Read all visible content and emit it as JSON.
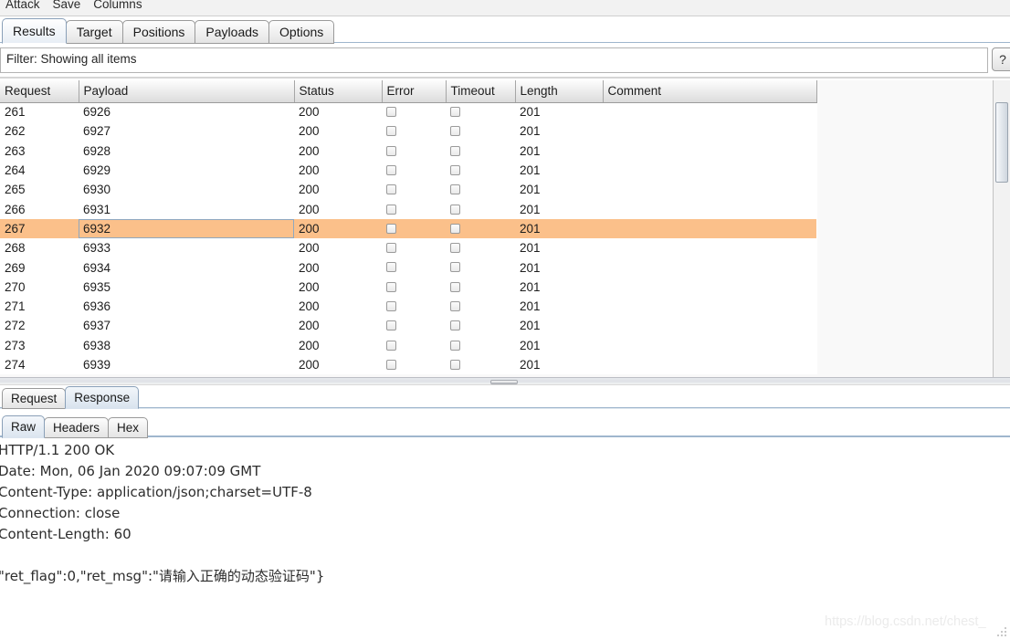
{
  "menubar": {
    "items": [
      {
        "label": "Attack"
      },
      {
        "label": "Save"
      },
      {
        "label": "Columns"
      }
    ]
  },
  "tabs": [
    {
      "label": "Results",
      "active": true
    },
    {
      "label": "Target",
      "active": false
    },
    {
      "label": "Positions",
      "active": false
    },
    {
      "label": "Payloads",
      "active": false
    },
    {
      "label": "Options",
      "active": false
    }
  ],
  "filter": {
    "text": "Filter: Showing all items",
    "help_label": "?"
  },
  "table": {
    "columns": [
      {
        "label": "Request"
      },
      {
        "label": "Payload"
      },
      {
        "label": "Status"
      },
      {
        "label": "Error"
      },
      {
        "label": "Timeout"
      },
      {
        "label": "Length"
      },
      {
        "label": "Comment"
      }
    ],
    "rows": [
      {
        "request": "261",
        "payload": "6926",
        "status": "200",
        "error": false,
        "timeout": false,
        "length": "201",
        "comment": "",
        "selected": false
      },
      {
        "request": "262",
        "payload": "6927",
        "status": "200",
        "error": false,
        "timeout": false,
        "length": "201",
        "comment": "",
        "selected": false
      },
      {
        "request": "263",
        "payload": "6928",
        "status": "200",
        "error": false,
        "timeout": false,
        "length": "201",
        "comment": "",
        "selected": false
      },
      {
        "request": "264",
        "payload": "6929",
        "status": "200",
        "error": false,
        "timeout": false,
        "length": "201",
        "comment": "",
        "selected": false
      },
      {
        "request": "265",
        "payload": "6930",
        "status": "200",
        "error": false,
        "timeout": false,
        "length": "201",
        "comment": "",
        "selected": false
      },
      {
        "request": "266",
        "payload": "6931",
        "status": "200",
        "error": false,
        "timeout": false,
        "length": "201",
        "comment": "",
        "selected": false
      },
      {
        "request": "267",
        "payload": "6932",
        "status": "200",
        "error": false,
        "timeout": false,
        "length": "201",
        "comment": "",
        "selected": true
      },
      {
        "request": "268",
        "payload": "6933",
        "status": "200",
        "error": false,
        "timeout": false,
        "length": "201",
        "comment": "",
        "selected": false
      },
      {
        "request": "269",
        "payload": "6934",
        "status": "200",
        "error": false,
        "timeout": false,
        "length": "201",
        "comment": "",
        "selected": false
      },
      {
        "request": "270",
        "payload": "6935",
        "status": "200",
        "error": false,
        "timeout": false,
        "length": "201",
        "comment": "",
        "selected": false
      },
      {
        "request": "271",
        "payload": "6936",
        "status": "200",
        "error": false,
        "timeout": false,
        "length": "201",
        "comment": "",
        "selected": false
      },
      {
        "request": "272",
        "payload": "6937",
        "status": "200",
        "error": false,
        "timeout": false,
        "length": "201",
        "comment": "",
        "selected": false
      },
      {
        "request": "273",
        "payload": "6938",
        "status": "200",
        "error": false,
        "timeout": false,
        "length": "201",
        "comment": "",
        "selected": false
      },
      {
        "request": "274",
        "payload": "6939",
        "status": "200",
        "error": false,
        "timeout": false,
        "length": "201",
        "comment": "",
        "selected": false
      }
    ],
    "selected_row_color": "#fbc08a"
  },
  "message_tabs": [
    {
      "label": "Request",
      "active": false
    },
    {
      "label": "Response",
      "active": true
    }
  ],
  "view_tabs": [
    {
      "label": "Raw",
      "active": true
    },
    {
      "label": "Headers",
      "active": false
    },
    {
      "label": "Hex",
      "active": false
    }
  ],
  "response": {
    "lines": [
      "HTTP/1.1 200 OK",
      "Date: Mon, 06 Jan 2020 09:07:09 GMT",
      "Content-Type: application/json;charset=UTF-8",
      "Connection: close",
      "Content-Length: 60"
    ],
    "body": "\"ret_flag\":0,\"ret_msg\":\"请输入正确的动态验证码\"}"
  },
  "watermark": {
    "text": "https://blog.csdn.net/chest_"
  }
}
